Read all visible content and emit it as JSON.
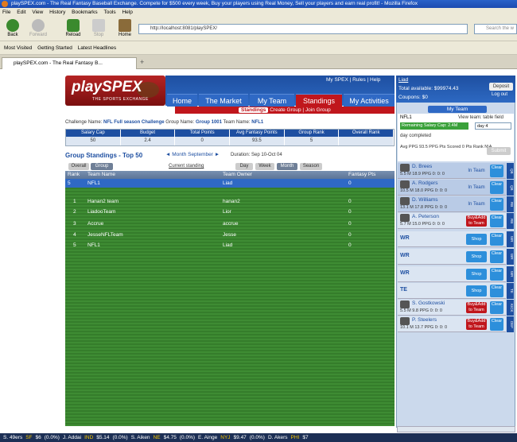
{
  "browser": {
    "title": "playSPEX.com - The Real Fantasy Baseball Exchange. Compete for $500 every week, Buy your players using Real Money, Sell your players and earn real profit! - Mozilla Firefox",
    "menu": [
      "File",
      "Edit",
      "View",
      "History",
      "Bookmarks",
      "Tools",
      "Help"
    ],
    "nav": {
      "back": "Back",
      "forward": "Forward",
      "reload": "Reload",
      "stop": "Stop",
      "home": "Home"
    },
    "url": "http://localhost:8081/playSPEX/",
    "search_placeholder": "Search the w",
    "bookmarks": [
      "Most Visited",
      "Getting Started",
      "Latest Headlines"
    ],
    "tab": "playSPEX.com - The Real Fantasy B..."
  },
  "site": {
    "logo": "playSPEX",
    "logo_sub": "THE SPORTS EXCHANGE",
    "toplinks": "My SPEX | Rules | Help",
    "tabs": [
      "Home",
      "The Market",
      "My Team",
      "Standings",
      "My Activities"
    ],
    "subnav": {
      "active": "Standings",
      "items": "Create Group | Join Group"
    }
  },
  "challenge": {
    "labels": {
      "challenge": "Challenge Name:",
      "group": "Group Name:",
      "team": "Team Name:"
    },
    "challenge_name": "NFL Full season Challenge",
    "group_name": "Group 1001",
    "team_name": "NFL1",
    "headers": [
      "Salary Cap",
      "Budget",
      "Total Points",
      "Avg Fantasy Points",
      "Group Rank",
      "Overall Rank"
    ],
    "values": [
      "50",
      "2.4",
      "0",
      "93.5",
      "5",
      ""
    ]
  },
  "standings": {
    "title": "Group Standings - Top 50",
    "month": "◄ Month September ►",
    "duration": "Duration: Sep 10-Oct 04",
    "current_standing": "Current standing",
    "left_tabs": [
      "Overall",
      "Group"
    ],
    "period_tabs": [
      "Day",
      "Week",
      "Month",
      "Season"
    ],
    "columns": [
      "Rank",
      "Team Name",
      "Team Owner",
      "Fantasy Pts"
    ],
    "my_row": {
      "rank": "5",
      "team": "NFL1",
      "owner": "Liad",
      "pts": "0"
    },
    "rows": [
      {
        "rank": "1",
        "team": "Hanan2 team",
        "owner": "hanan2",
        "pts": "0"
      },
      {
        "rank": "2",
        "team": "LiadooTeam",
        "owner": "Lior",
        "pts": "0"
      },
      {
        "rank": "3",
        "team": "Accrue",
        "owner": "accrue",
        "pts": "0"
      },
      {
        "rank": "4",
        "team": "JesseNFLTeam",
        "owner": "Jesse",
        "pts": "0"
      },
      {
        "rank": "5",
        "team": "NFL1",
        "owner": "Liad",
        "pts": "0"
      }
    ]
  },
  "panel": {
    "user": "Liad",
    "balance": "Total available: $99974.43",
    "coupons": "Coupons: $0",
    "deposit": "Deposit",
    "logout": "Log out",
    "my_team": "My Team",
    "team": "NFL1",
    "view_team": "View team: table field",
    "remaining": "Remaining Salary Cap: 2.4M",
    "day": "day 4",
    "day_completed": "day completed",
    "stats": "Avg PPG 93.5 PPG   Pts Scored 0 Pts   Rank N\\A",
    "submit": "Submit",
    "players": [
      {
        "name": "D. Brees",
        "stats": "5.5 M 18.9 PPG 0: 0: 0",
        "action": "In Team",
        "side": "QB",
        "alt": true
      },
      {
        "name": "A. Rodgers",
        "stats": "10.5 M 18.0 PPG 0: 0: 0",
        "action": "In Team",
        "side": "QB",
        "alt": true
      },
      {
        "name": "D. Williams",
        "stats": "13.1 M 17.8 PPG 0: 0: 0",
        "action": "In Team",
        "side": "RB",
        "alt": true
      },
      {
        "name": "A. Peterson",
        "stats": "5.7 M 15.0 PPG 0: 0: 0",
        "action": "Buy&Add to Team",
        "side": "RB",
        "alt": false
      },
      {
        "name": "WR",
        "stats": "",
        "action": "Shop",
        "side": "WR",
        "alt": false
      },
      {
        "name": "WR",
        "stats": "",
        "action": "Shop",
        "side": "WR",
        "alt": false
      },
      {
        "name": "WR",
        "stats": "",
        "action": "Shop",
        "side": "WR",
        "alt": false
      },
      {
        "name": "TE",
        "stats": "",
        "action": "Shop",
        "side": "TE",
        "alt": false
      },
      {
        "name": "S. Gostkowski",
        "stats": "5.5 M 9.8 PPG 0: 0: 0",
        "action": "Buy&Add to Team",
        "side": "KICK",
        "alt": false
      },
      {
        "name": "P. Steelers",
        "stats": "10.1 M 13.7 PPG 0: 0: 0",
        "action": "Buy&Add to Team",
        "side": "DEF",
        "alt": false
      }
    ],
    "clear": "Clear"
  },
  "ticker": [
    {
      "name": "S. 49ers",
      "team": "SF",
      "price": "$6",
      "chg": "(0.0%)"
    },
    {
      "name": "J. Addai",
      "team": "IND",
      "price": "$5.14",
      "chg": "(0.0%)"
    },
    {
      "name": "S. Aiken",
      "team": "NE",
      "price": "$4.75",
      "chg": "(0.0%)"
    },
    {
      "name": "E. Ainge",
      "team": "NYJ",
      "price": "$9.47",
      "chg": "(0.0%)"
    },
    {
      "name": "D. Akers",
      "team": "PHI",
      "price": "$7"
    }
  ]
}
